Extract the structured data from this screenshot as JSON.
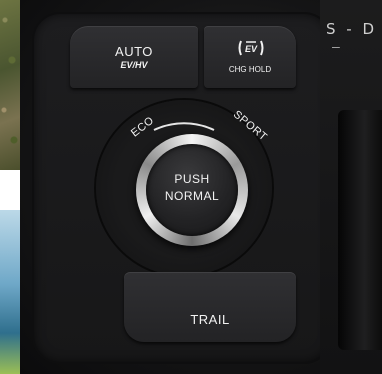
{
  "buttons": {
    "auto_label": "AUTO",
    "ev_hv_label": "EV/HV",
    "chg_hold_label": "CHG HOLD",
    "trail_label": "TRAIL"
  },
  "dial": {
    "push_label": "PUSH",
    "normal_label": "NORMAL",
    "eco_label": "ECO",
    "sport_label": "SPORT"
  },
  "gear": {
    "indicator_text": "S - D",
    "dash": "–"
  },
  "colors": {
    "panel": "#141415",
    "text": "#f2f2f2",
    "chrome": "#d8d8d8"
  }
}
